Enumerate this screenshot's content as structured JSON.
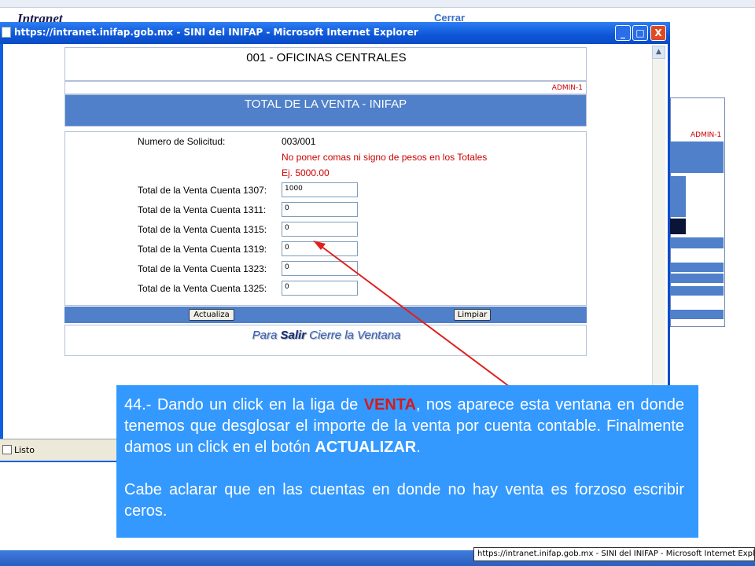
{
  "background": {
    "logo": "Intranet",
    "cerrar": "Cerrar",
    "admin": "ADMIN-1",
    "taskbar_item": "https://intranet.inifap.gob.mx - SINI del INIFAP - Microsoft Internet Explorer"
  },
  "window": {
    "title": "https://intranet.inifap.gob.mx - SINI del INIFAP - Microsoft Internet Explorer",
    "minimize": "_",
    "maximize": "□",
    "close": "X",
    "status": "Listo"
  },
  "form": {
    "office": "001 - OFICINAS CENTRALES",
    "admin": "ADMIN-1",
    "header": "TOTAL DE LA VENTA - INIFAP",
    "solicitud_label": "Numero de Solicitud:",
    "solicitud_value": "003/001",
    "warning1": "No poner comas ni signo de pesos en los Totales",
    "warning2": "Ej. 5000.00",
    "fields": [
      {
        "label": "Total de la Venta Cuenta 1307:",
        "value": "1000"
      },
      {
        "label": "Total de la Venta Cuenta 1311:",
        "value": "0"
      },
      {
        "label": "Total de la Venta Cuenta 1315:",
        "value": "0"
      },
      {
        "label": "Total de la Venta Cuenta 1319:",
        "value": "0"
      },
      {
        "label": "Total de la Venta Cuenta 1323:",
        "value": "0"
      },
      {
        "label": "Total de la Venta Cuenta 1325:",
        "value": "0"
      }
    ],
    "btn_actualiza": "Actualiza",
    "btn_limpiar": "Limpiar",
    "footer_pre": "Para ",
    "footer_bold": "Salir",
    "footer_post": " Cierre la Ventana"
  },
  "callout": {
    "p1_a": "44.- Dando un click en la liga de ",
    "p1_hl": "VENTA",
    "p1_b": ", nos aparece esta ventana en donde tenemos que desglosar el importe de la venta por cuenta contable. Finalmente damos un click en el botón ",
    "p1_bold": "ACTUALIZAR",
    "p1_c": ".",
    "p2": "Cabe aclarar que en las cuentas en donde no hay venta es forzoso escribir ceros."
  },
  "colors": {
    "header_blue": "#4f80c9",
    "callout_blue": "#3399ff",
    "warning_red": "#cc0000",
    "arrow_red": "#e02020"
  }
}
